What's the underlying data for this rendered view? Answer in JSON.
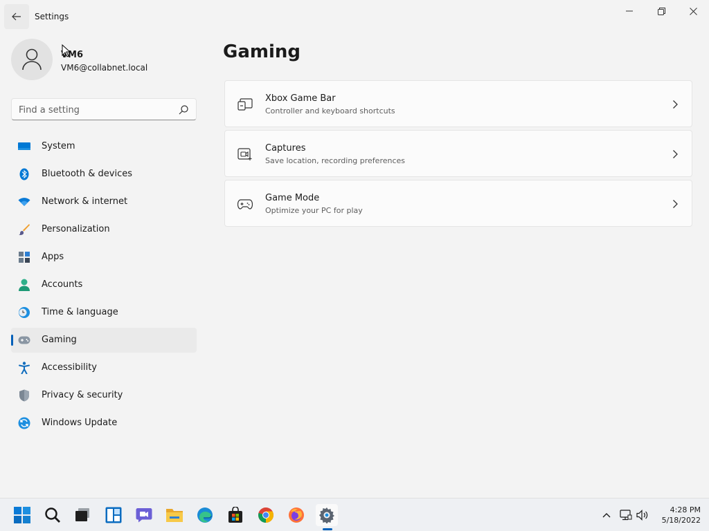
{
  "window": {
    "title": "Settings"
  },
  "profile": {
    "name": "VM6",
    "email": "VM6@collabnet.local"
  },
  "search": {
    "placeholder": "Find a setting"
  },
  "nav": {
    "items": [
      {
        "label": "System",
        "icon": "monitor-icon"
      },
      {
        "label": "Bluetooth & devices",
        "icon": "bluetooth-icon"
      },
      {
        "label": "Network & internet",
        "icon": "wifi-icon"
      },
      {
        "label": "Personalization",
        "icon": "brush-icon"
      },
      {
        "label": "Apps",
        "icon": "apps-icon"
      },
      {
        "label": "Accounts",
        "icon": "person-icon"
      },
      {
        "label": "Time & language",
        "icon": "clock-globe-icon"
      },
      {
        "label": "Gaming",
        "icon": "gamepad-icon",
        "selected": true
      },
      {
        "label": "Accessibility",
        "icon": "accessibility-icon"
      },
      {
        "label": "Privacy & security",
        "icon": "shield-icon"
      },
      {
        "label": "Windows Update",
        "icon": "update-icon"
      }
    ]
  },
  "main": {
    "title": "Gaming",
    "cards": [
      {
        "title": "Xbox Game Bar",
        "subtitle": "Controller and keyboard shortcuts",
        "icon": "game-bar-icon"
      },
      {
        "title": "Captures",
        "subtitle": "Save location, recording preferences",
        "icon": "capture-icon"
      },
      {
        "title": "Game Mode",
        "subtitle": "Optimize your PC for play",
        "icon": "gamepad-icon"
      }
    ]
  },
  "taskbar": {
    "apps": [
      "start-icon",
      "search-icon",
      "task-view-icon",
      "widgets-icon",
      "chat-icon",
      "file-explorer-icon",
      "edge-icon",
      "store-icon",
      "chrome-icon",
      "firefox-icon",
      "settings-icon"
    ],
    "time": "4:28 PM",
    "date": "5/18/2022"
  },
  "colors": {
    "accent": "#005fb8",
    "background": "#f3f3f3",
    "card": "#fbfbfb"
  }
}
